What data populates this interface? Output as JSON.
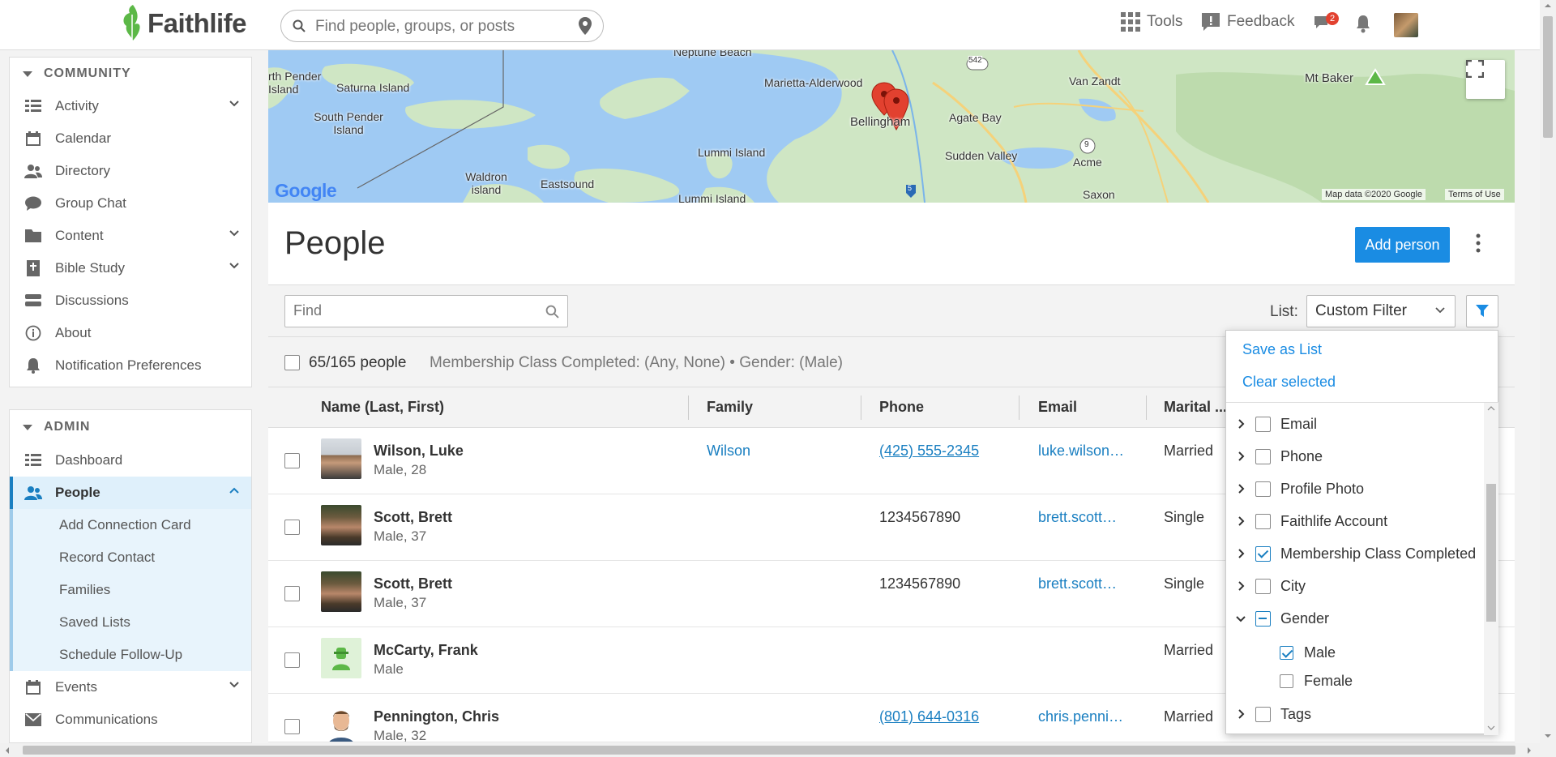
{
  "header": {
    "brand": "Faithlife",
    "search_placeholder": "Find people, groups, or posts",
    "tools_label": "Tools",
    "feedback_label": "Feedback",
    "chat_badge": "2"
  },
  "sidebar": {
    "community": {
      "title": "COMMUNITY",
      "items": [
        {
          "label": "Activity"
        },
        {
          "label": "Calendar"
        },
        {
          "label": "Directory"
        },
        {
          "label": "Group Chat"
        },
        {
          "label": "Content"
        },
        {
          "label": "Bible Study"
        },
        {
          "label": "Discussions"
        },
        {
          "label": "About"
        },
        {
          "label": "Notification Preferences"
        }
      ]
    },
    "admin": {
      "title": "ADMIN",
      "items": [
        {
          "label": "Dashboard"
        },
        {
          "label": "People"
        },
        {
          "label": "Events"
        },
        {
          "label": "Communications"
        }
      ],
      "people_sub": [
        {
          "label": "Add Connection Card"
        },
        {
          "label": "Record Contact"
        },
        {
          "label": "Families"
        },
        {
          "label": "Saved Lists"
        },
        {
          "label": "Schedule Follow-Up"
        }
      ]
    }
  },
  "map": {
    "labels": [
      "Neptune Beach",
      "rth Pender Island",
      "Saturna Island",
      "South Pender Island",
      "Marietta-Alderwood",
      "Bellingham",
      "Agate Bay",
      "Van Zandt",
      "Mt Baker",
      "Lummi Island",
      "Sudden Valley",
      "Acme",
      "Waldron island",
      "Eastsound",
      "Lummi Island",
      "Saxon",
      "Bellingham"
    ],
    "attribution": "Map data ©2020 Google",
    "terms": "Terms of Use",
    "google": "Google",
    "road_shields": [
      "542",
      "9",
      "5"
    ]
  },
  "page": {
    "title": "People",
    "add_button": "Add person"
  },
  "toolbar": {
    "find_placeholder": "Find",
    "list_label": "List:",
    "list_value": "Custom Filter"
  },
  "summary": {
    "count": "65/165 people",
    "criteria": "Membership Class Completed: (Any, None) • Gender: (Male)"
  },
  "table": {
    "columns": [
      "Name (Last, First)",
      "Family",
      "Phone",
      "Email",
      "Marital ..."
    ],
    "rows": [
      {
        "name": "Wilson, Luke",
        "meta": "Male, 28",
        "family": "Wilson",
        "phone": "(425) 555-2345",
        "email": "luke.wilson@example.com",
        "marital": "Married"
      },
      {
        "name": "Scott, Brett",
        "meta": "Male, 37",
        "family": "",
        "phone": "1234567890",
        "email": "brett.scott@example.com",
        "marital": "Single"
      },
      {
        "name": "Scott, Brett",
        "meta": "Male, 37",
        "family": "",
        "phone": "1234567890",
        "email": "brett.scott@example.com",
        "marital": "Single"
      },
      {
        "name": "McCarty, Frank",
        "meta": "Male",
        "family": "",
        "phone": "",
        "email": "",
        "marital": "Married"
      },
      {
        "name": "Pennington, Chris",
        "meta": "Male, 32",
        "family": "",
        "phone": "(801) 644-0316",
        "email": "chris.pennington@example.com",
        "marital": "Married"
      }
    ]
  },
  "filter_menu": {
    "save_as_list": "Save as List",
    "clear_selected": "Clear selected",
    "items": [
      {
        "label": "Email",
        "checked": false
      },
      {
        "label": "Phone",
        "checked": false
      },
      {
        "label": "Profile Photo",
        "checked": false
      },
      {
        "label": "Faithlife Account",
        "checked": false
      },
      {
        "label": "Membership Class Completed",
        "checked": true
      },
      {
        "label": "City",
        "checked": false
      },
      {
        "label": "Gender",
        "checked": "partial"
      },
      {
        "label": "Tags",
        "checked": false
      }
    ],
    "gender_options": [
      {
        "label": "Male",
        "checked": true
      },
      {
        "label": "Female",
        "checked": false
      }
    ]
  },
  "colors": {
    "accent": "#1a8ce3",
    "brand_green": "#5cb847",
    "map_water": "#9fcaf3",
    "map_land": "#cfe6c4"
  }
}
